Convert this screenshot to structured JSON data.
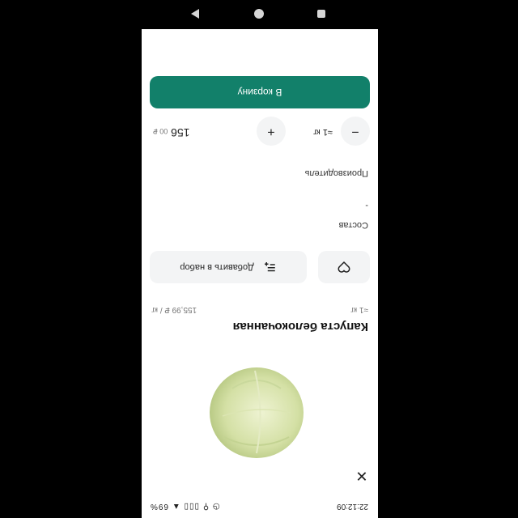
{
  "status_bar": {
    "time": "22:12:09",
    "icons": "◷ ⚲  ▯▯▯ ▲ 69%"
  },
  "product": {
    "title": "Капуста белокочанная",
    "weight": "≈1 кг",
    "unit_price": "155,99 ₽ / кг",
    "image": "cabbage"
  },
  "actions": {
    "set_label": "Добавить в набор"
  },
  "sections": {
    "composition": "Состав",
    "composition_value": "-",
    "manufacturer": "Производитель"
  },
  "quantity": {
    "value": "≈1 кг",
    "minus": "−",
    "plus": "+"
  },
  "price": {
    "main": "156",
    "fraction": "00 ₽"
  },
  "cart_button": "В корзину",
  "icons": {
    "close": "close-icon",
    "favorite": "heart-icon",
    "set": "playlist-add-icon"
  },
  "colors": {
    "accent": "#12806a"
  }
}
